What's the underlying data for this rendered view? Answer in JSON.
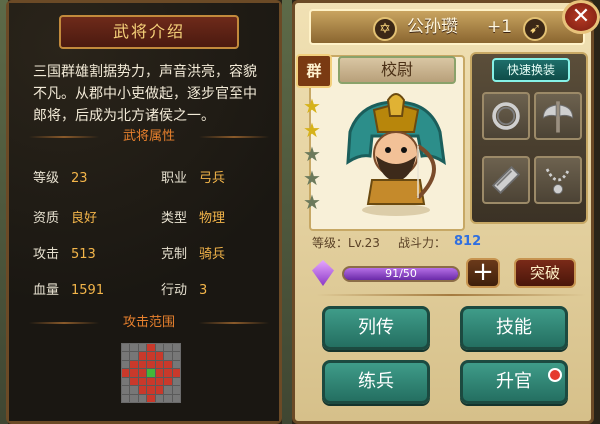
{
  "left": {
    "header": "武将介绍",
    "bio": "三国群雄割据势力，声音洪亮，容貌不凡。从郡中小吏做起，逐步官至中郎将，后成为北方诸侯之一。",
    "attr_title": "武将属性",
    "range_title": "攻击范围",
    "stats": [
      {
        "k": "等级",
        "v": "23"
      },
      {
        "k": "职业",
        "v": "弓兵"
      },
      {
        "k": "资质",
        "v": "良好"
      },
      {
        "k": "类型",
        "v": "物理"
      },
      {
        "k": "攻击",
        "v": "513"
      },
      {
        "k": "克制",
        "v": "骑兵"
      },
      {
        "k": "血量",
        "v": "1591"
      },
      {
        "k": "行动",
        "v": "3"
      }
    ],
    "range_grid": [
      "gggrggg",
      "ggrrrgg",
      "grrrrrg",
      "rrrgrrr",
      "grrrrrg",
      "ggrrrgg",
      "gggrggg"
    ]
  },
  "right": {
    "name": "公孙瓒",
    "plus": "+1",
    "faction": "群",
    "rank": "校尉",
    "quick_equip": "快速换装",
    "stars_on": 2,
    "stars_total": 5,
    "level_text": "等级：Lv.23",
    "power_label": "战斗力：",
    "power_value": "812",
    "exp_text": "91/50",
    "exp_ratio": 1.0,
    "break_label": "突破",
    "buttons": {
      "liezhuan": "列传",
      "jineng": "技能",
      "lianbing": "练兵",
      "shengguan": "升官"
    },
    "icons": {
      "faction_badge": "hexagram-icon",
      "class_badge": "bow-icon",
      "close": "close-icon",
      "equip_slots": [
        "ring-icon",
        "axe-icon",
        "scroll-icon",
        "necklace-icon"
      ]
    }
  }
}
